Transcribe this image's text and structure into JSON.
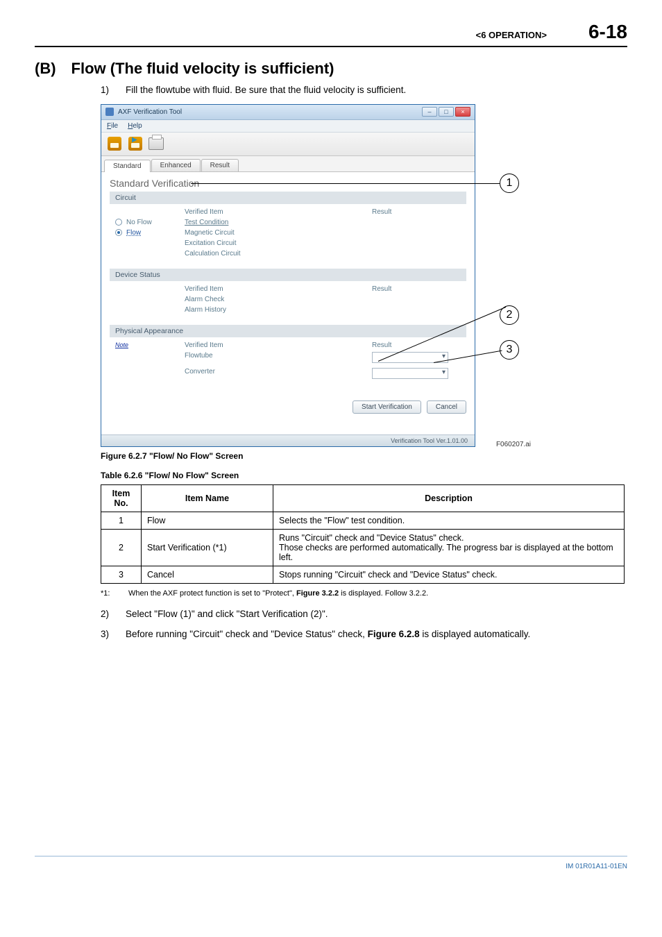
{
  "header": {
    "section": "<6  OPERATION>",
    "page": "6-18"
  },
  "section": {
    "letter": "(B)",
    "heading": "Flow (The fluid velocity is sufficient)"
  },
  "lines": {
    "l1_num": "1)",
    "l1_text": "Fill the flowtube with fluid. Be sure that the fluid velocity is sufficient.",
    "l2_num": "2)",
    "l2_text": "Select \"Flow (1)\" and click \"Start Verification (2)\".",
    "l3_num": "3)",
    "l3_text_a": "Before running \"Circuit\" check and \"Device Status\" check, ",
    "l3_bold": "Figure 6.2.8",
    "l3_text_b": " is displayed automatically."
  },
  "win": {
    "title": "AXF Verification Tool",
    "menu_file": "File",
    "menu_help": "Help",
    "tab_standard": "Standard",
    "tab_enhanced": "Enhanced",
    "tab_result": "Result",
    "panel_title": "Standard Verification",
    "circuit": {
      "header": "Circuit",
      "col_item": "Verified Item",
      "col_result": "Result",
      "noflow": "No Flow",
      "flow": "Flow",
      "items": {
        "a": "Test Condition",
        "b": "Magnetic Circuit",
        "c": "Excitation Circuit",
        "d": "Calculation Circuit"
      }
    },
    "device": {
      "header": "Device Status",
      "col_item": "Verified Item",
      "col_result": "Result",
      "items": {
        "a": "Alarm Check",
        "b": "Alarm History"
      }
    },
    "phys": {
      "header": "Physical Appearance",
      "note": "Note",
      "col_item": "Verified Item",
      "col_result": "Result",
      "items": {
        "a": "Flowtube",
        "b": "Converter"
      }
    },
    "btn_start": "Start Verification",
    "btn_cancel": "Cancel",
    "status": "Verification Tool Ver.1.01.00"
  },
  "callouts": {
    "c1": "1",
    "c2": "2",
    "c3": "3"
  },
  "figure": {
    "file_label": "F060207.ai",
    "caption": "Figure 6.2.7 \"Flow/ No Flow\" Screen"
  },
  "tableTitle": "Table 6.2.6 \"Flow/ No Flow\" Screen",
  "table": {
    "h1": "Item No.",
    "h2": "Item Name",
    "h3": "Description",
    "rows": {
      "r1": {
        "no": "1",
        "name": "Flow",
        "desc": "Selects the \"Flow\" test condition."
      },
      "r2": {
        "no": "2",
        "name": "Start Verification (*1)",
        "desc": "Runs \"Circuit\" check and \"Device Status\" check.\nThose checks are performed automatically. The progress bar is displayed at the bottom left."
      },
      "r3": {
        "no": "3",
        "name": "Cancel",
        "desc": "Stops running \"Circuit\" check and \"Device Status\" check."
      }
    }
  },
  "footnote": {
    "key": "*1:",
    "text_a": "When the AXF protect function is set to \"Protect\", ",
    "bold": "Figure 3.2.2",
    "text_b": " is displayed. Follow 3.2.2."
  },
  "docId": "IM 01R01A11-01EN"
}
